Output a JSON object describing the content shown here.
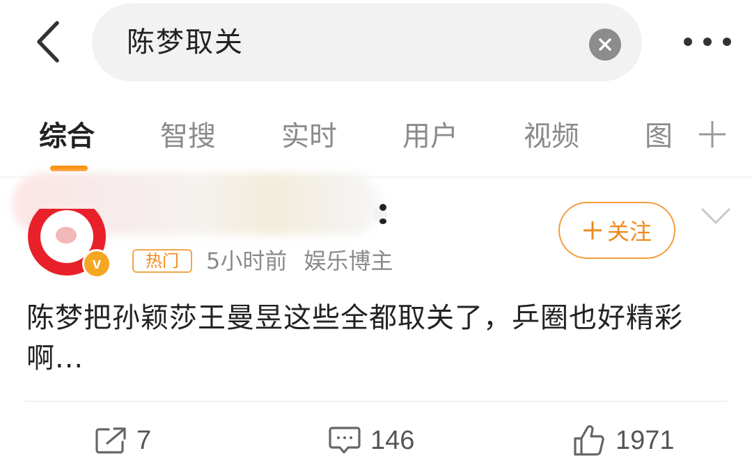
{
  "search": {
    "query": "陈梦取关"
  },
  "tabs": [
    {
      "label": "综合",
      "active": true
    },
    {
      "label": "智搜",
      "active": false
    },
    {
      "label": "实时",
      "active": false
    },
    {
      "label": "用户",
      "active": false
    },
    {
      "label": "视频",
      "active": false
    },
    {
      "label": "图",
      "active": false
    }
  ],
  "post": {
    "hot_tag": "热门",
    "time": "5小时前",
    "user_type": "娱乐博主",
    "follow_label": "关注",
    "text": "陈梦把孙颖莎王曼昱这些全都取关了，乒圈也好精彩啊...",
    "verified_badge": "v",
    "actions": {
      "repost_count": "7",
      "comment_count": "146",
      "like_count": "1971"
    }
  },
  "colors": {
    "accent": "#ff8a00",
    "follow": "#f08a1c",
    "badge": "#f5a623",
    "avatar_ring": "#e8202a"
  },
  "icons": [
    "back-arrow-icon",
    "clear-icon",
    "more-icon",
    "add-tab-icon",
    "verified-icon",
    "chevron-down-icon",
    "repost-icon",
    "comment-icon",
    "like-icon"
  ]
}
